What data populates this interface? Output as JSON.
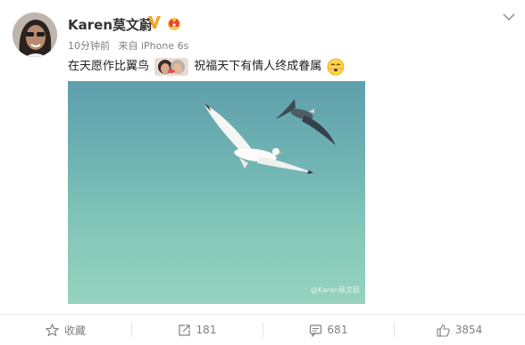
{
  "post": {
    "username": "Karen莫文蔚",
    "time": "10分钟前",
    "source": "来自 iPhone 6s",
    "text_before": "在天愿作比翼鸟",
    "text_after": "祝福天下有情人终成眷属",
    "photo_watermark": "@Karen莫文蔚"
  },
  "icons": {
    "verified": "verified-v-icon",
    "vip": "vip-crown-icon",
    "menu": "chevron-down-icon",
    "inline_emoji_1": "couple-photo-emoji",
    "inline_emoji_2": "blushing-face-emoji",
    "favorite": "star-icon",
    "repost": "repost-icon",
    "comment": "comment-icon",
    "like": "thumbs-up-icon"
  },
  "actions": {
    "favorite_label": "收藏",
    "repost_count": "181",
    "comment_count": "681",
    "like_count": "3854"
  },
  "colors": {
    "verified": "#f5a623",
    "sky_top": "#5f9fac",
    "sky_bottom": "#97d3bf",
    "meta_text": "#808080"
  }
}
